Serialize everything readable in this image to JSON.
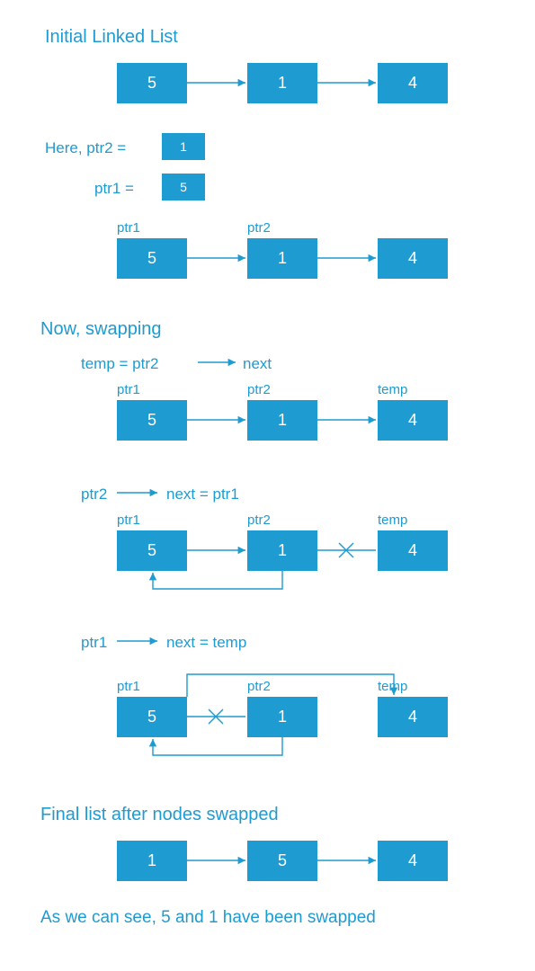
{
  "colors": {
    "brand": "#1e9bd1",
    "node_fill": "#1e9bd1",
    "node_text": "#ffffff"
  },
  "headings": {
    "initial": "Initial Linked List",
    "swapping": "Now,   swapping",
    "final": "Final list after nodes swapped",
    "conclusion": "As we can see,  5 and 1 have been swapped"
  },
  "assign_lines": {
    "here": "Here,   ptr2  =",
    "ptr1_eq": "ptr1  =",
    "temp_eq_ptr2_next_lhs": "temp  =  ptr2",
    "temp_eq_ptr2_next_rhs": "next",
    "ptr2_next_ptr1_lhs": "ptr2",
    "ptr2_next_ptr1_rhs": "next  =  ptr1",
    "ptr1_next_temp_lhs": "ptr1",
    "ptr1_next_temp_rhs": "next  =  temp"
  },
  "ptr_labels": {
    "ptr1": "ptr1",
    "ptr2": "ptr2",
    "temp": "temp"
  },
  "lists": {
    "initial": {
      "n1": "5",
      "n2": "1",
      "n3": "4"
    },
    "small": {
      "ptr2_val": "1",
      "ptr1_val": "5"
    },
    "row2": {
      "n1": "5",
      "n2": "1",
      "n3": "4"
    },
    "row3": {
      "n1": "5",
      "n2": "1",
      "n3": "4"
    },
    "row4": {
      "n1": "5",
      "n2": "1",
      "n3": "4"
    },
    "row5": {
      "n1": "5",
      "n2": "1",
      "n3": "4"
    },
    "final": {
      "n1": "1",
      "n2": "5",
      "n3": "4"
    }
  }
}
